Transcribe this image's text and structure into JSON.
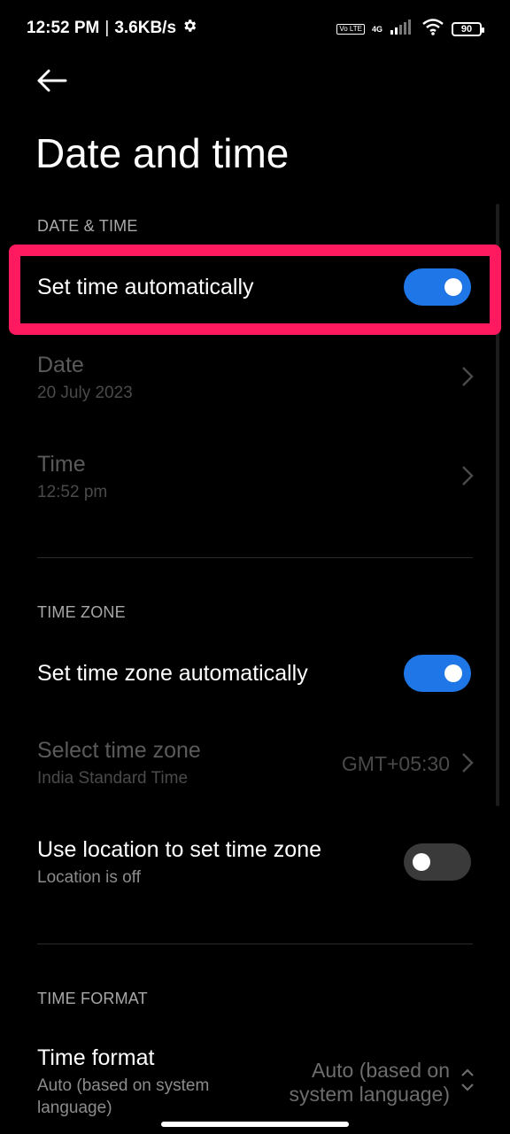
{
  "status_bar": {
    "time": "12:52 PM",
    "separator": "|",
    "speed": "3.6KB/s",
    "volte": "Vo LTE",
    "network": "4G",
    "battery": "90"
  },
  "page": {
    "title": "Date and time"
  },
  "sections": {
    "date_time": {
      "header": "DATE & TIME"
    },
    "time_zone": {
      "header": "TIME ZONE"
    },
    "time_format": {
      "header": "TIME FORMAT"
    }
  },
  "rows": {
    "set_time_auto": {
      "title": "Set time automatically",
      "enabled": true
    },
    "date": {
      "title": "Date",
      "value": "20 July 2023"
    },
    "time": {
      "title": "Time",
      "value": "12:52 pm"
    },
    "set_tz_auto": {
      "title": "Set time zone automatically",
      "enabled": true
    },
    "select_tz": {
      "title": "Select time zone",
      "subtitle": "India Standard Time",
      "value": "GMT+05:30"
    },
    "use_location": {
      "title": "Use location to set time zone",
      "subtitle": "Location is off",
      "enabled": false
    },
    "time_format": {
      "title": "Time format",
      "subtitle_line1": "Auto (based on system",
      "subtitle_line2": "language)",
      "value_line1": "Auto (based on",
      "value_line2": "system language)"
    }
  },
  "icons": {
    "back": "arrow-left-icon",
    "settings": "gear-icon",
    "chevron": "chevron-right-icon",
    "updown": "chevron-up-down-icon"
  },
  "colors": {
    "accent": "#1f76e6",
    "highlight": "#ff1a5f",
    "background": "#000000"
  }
}
